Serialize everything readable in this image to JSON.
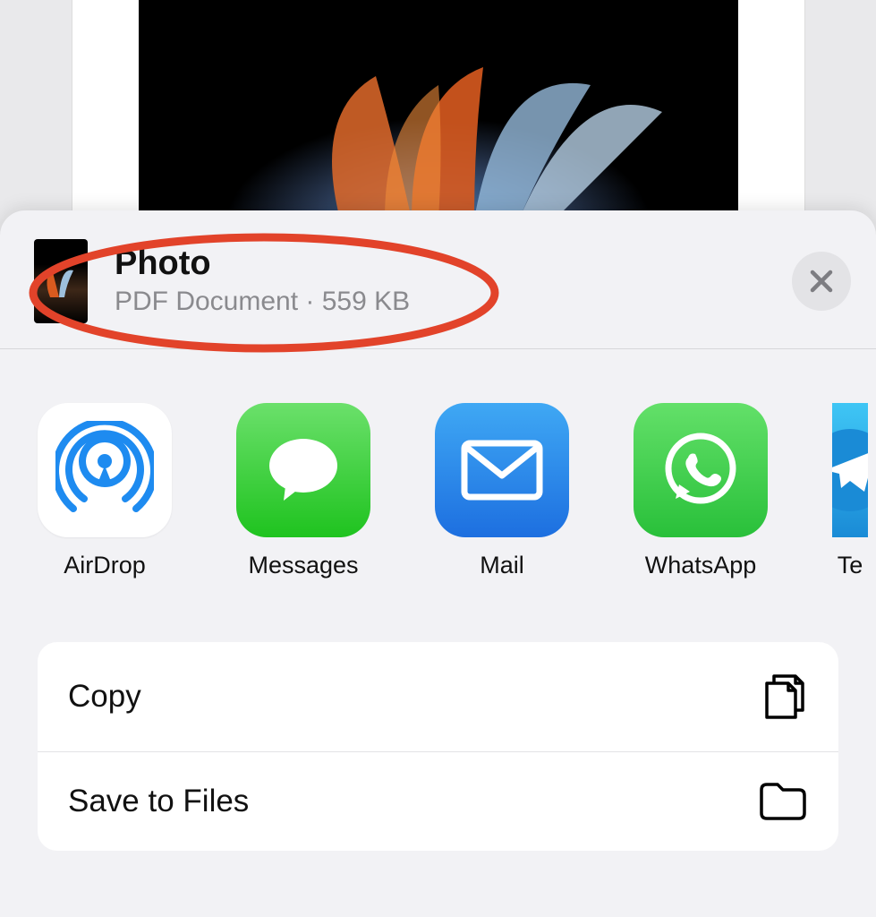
{
  "header": {
    "title": "Photo",
    "subtitle": "PDF Document · 559 KB"
  },
  "share_targets": [
    {
      "id": "airdrop",
      "label": "AirDrop",
      "icon": "airdrop-icon"
    },
    {
      "id": "messages",
      "label": "Messages",
      "icon": "messages-icon"
    },
    {
      "id": "mail",
      "label": "Mail",
      "icon": "mail-icon"
    },
    {
      "id": "whatsapp",
      "label": "WhatsApp",
      "icon": "whatsapp-icon"
    },
    {
      "id": "telegram",
      "label": "Te",
      "icon": "telegram-icon"
    }
  ],
  "actions": [
    {
      "id": "copy",
      "label": "Copy",
      "icon": "copy-icon"
    },
    {
      "id": "files",
      "label": "Save to Files",
      "icon": "folder-icon"
    }
  ],
  "annotation": {
    "color": "#e2432a"
  }
}
